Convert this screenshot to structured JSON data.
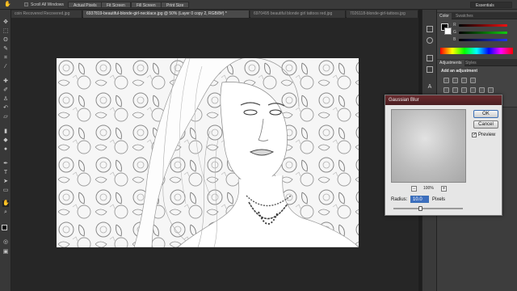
{
  "options_bar": {
    "scroll_all_windows": "Scroll All Windows",
    "buttons": [
      "Actual Pixels",
      "Fit Screen",
      "Fill Screen",
      "Print Size"
    ],
    "workspace": "Essentials"
  },
  "tabs": [
    {
      "label": "coin Recovered Recovered.jpg",
      "active": false
    },
    {
      "label": "6937819-beautiful-blonde-girl-necklace.jpg @ 50% (Layer 0 copy 2, RGB/8#) *",
      "active": true
    },
    {
      "label": "6970495 beautiful blonde girl tattoos red.jpg",
      "active": false
    },
    {
      "label": "7026118-blonde-girl-tattoos.jpg",
      "active": false
    }
  ],
  "color_panel": {
    "tabs": [
      "Color",
      "Swatches"
    ],
    "channels": [
      "R",
      "G",
      "B"
    ]
  },
  "adjustments_panel": {
    "tabs": [
      "Adjustments",
      "Styles"
    ],
    "heading": "Add an adjustment"
  },
  "dialog": {
    "title": "Gaussian Blur",
    "ok": "OK",
    "cancel": "Cancel",
    "preview_label": "Preview",
    "preview_checked": true,
    "zoom": "100%",
    "zoom_out": "−",
    "zoom_in": "+",
    "radius_label": "Radius:",
    "radius_value": "10.0",
    "unit": "Pixels"
  },
  "icons": {
    "tools": [
      "move-icon",
      "marquee-icon",
      "lasso-icon",
      "quick-select-icon",
      "crop-icon",
      "eyedropper-icon",
      "healing-icon",
      "brush-icon",
      "stamp-icon",
      "history-brush-icon",
      "eraser-icon",
      "gradient-icon",
      "blur-icon",
      "dodge-icon",
      "pen-icon",
      "type-icon",
      "path-select-icon",
      "shape-icon",
      "hand-icon",
      "zoom-icon"
    ]
  }
}
